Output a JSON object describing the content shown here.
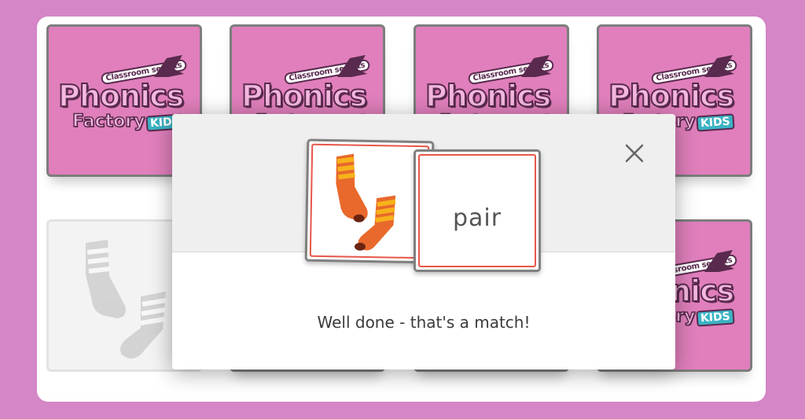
{
  "game": {
    "logo": {
      "small_text": "Classroom secrets",
      "big_text": "Phonics",
      "sub_text": "Factory",
      "badge_text": "KIDS"
    },
    "cards": [
      {
        "state": "face-down"
      },
      {
        "state": "face-down"
      },
      {
        "state": "face-down"
      },
      {
        "state": "face-down"
      },
      {
        "state": "matched",
        "image": "socks-icon"
      },
      {
        "state": "face-down"
      },
      {
        "state": "face-down"
      },
      {
        "state": "face-down"
      }
    ]
  },
  "modal": {
    "picture_card": {
      "image": "socks-icon"
    },
    "word_card": {
      "word": "pair"
    },
    "message": "Well done - that's a match!",
    "close_icon": "close-icon"
  },
  "colors": {
    "page_background": "#d486c6",
    "card_back": "#e07fbc",
    "card_border": "#7d7d7d",
    "match_border": "#e7564a"
  }
}
